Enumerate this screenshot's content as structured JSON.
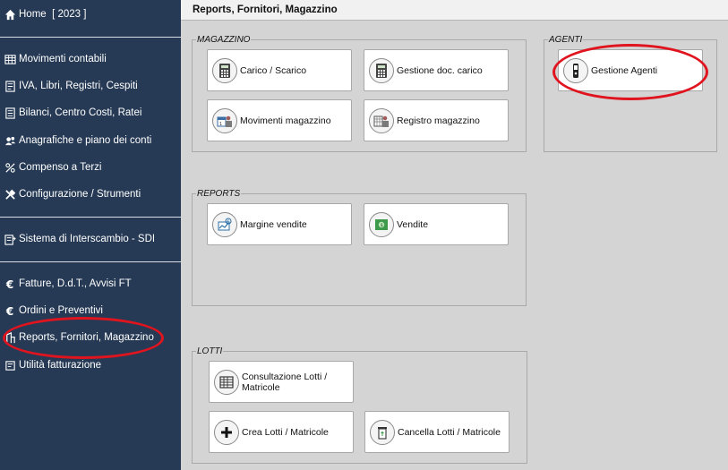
{
  "sidebar": {
    "home": "Home  [ 2023 ]",
    "items": [
      {
        "label": "Movimenti contabili",
        "icon": "table-icon"
      },
      {
        "label": "IVA, Libri, Registri, Cespiti",
        "icon": "book-icon"
      },
      {
        "label": "Bilanci, Centro Costi, Ratei",
        "icon": "balance-sheet-icon"
      },
      {
        "label": "Anagrafiche e piano dei conti",
        "icon": "people-icon"
      },
      {
        "label": "Compenso a Terzi",
        "icon": "percent-icon"
      },
      {
        "label": "Configurazione / Strumenti",
        "icon": "tools-icon"
      },
      {
        "label": "Sistema di Interscambio - SDI",
        "icon": "sdi-icon"
      },
      {
        "label": "Fatture, D.d.T., Avvisi FT",
        "icon": "euro-icon"
      },
      {
        "label": "Ordini e Preventivi",
        "icon": "euro-icon"
      },
      {
        "label": "Reports, Fornitori, Magazzino",
        "icon": "report-icon"
      },
      {
        "label": "Utilità fatturazione",
        "icon": "utility-icon"
      }
    ]
  },
  "header": {
    "title": "Reports, Fornitori, Magazzino"
  },
  "groups": {
    "magazzino": {
      "title": "MAGAZZINO",
      "buttons": [
        {
          "label": "Carico / Scarico",
          "icon": "calculator-icon"
        },
        {
          "label": "Gestione doc. carico",
          "icon": "calculator-icon"
        },
        {
          "label": "Movimenti magazzino",
          "icon": "warehouse-calendar-icon"
        },
        {
          "label": "Registro magazzino",
          "icon": "warehouse-register-icon"
        }
      ]
    },
    "agenti": {
      "title": "AGENTI",
      "buttons": [
        {
          "label": "Gestione Agenti",
          "icon": "agent-icon"
        }
      ]
    },
    "reports": {
      "title": "REPORTS",
      "buttons": [
        {
          "label": "Margine vendite",
          "icon": "chart-icon"
        },
        {
          "label": "Vendite",
          "icon": "money-icon"
        }
      ]
    },
    "lotti": {
      "title": "LOTTI",
      "buttons": [
        {
          "label": "Consultazione Lotti / Matricole",
          "icon": "grid-icon"
        },
        {
          "label": "Crea Lotti / Matricole",
          "icon": "plus-icon"
        },
        {
          "label": "Cancella Lotti / Matricole",
          "icon": "trash-icon"
        }
      ]
    }
  },
  "colors": {
    "sidebar_bg": "#263a55",
    "content_bg": "#d4d4d4",
    "annotation": "#e0141e"
  }
}
